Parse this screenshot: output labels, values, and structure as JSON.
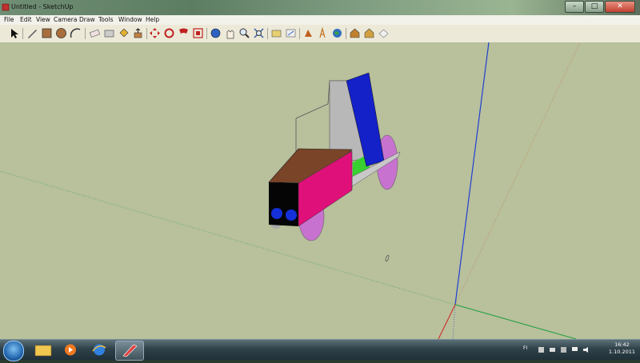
{
  "window": {
    "title": "Untitled - SketchUp"
  },
  "menu": {
    "items": [
      "File",
      "Edit",
      "View",
      "Camera",
      "Draw",
      "Tools",
      "Window",
      "Help"
    ]
  },
  "toolbar": {
    "tools": [
      "select-icon",
      "pencil-icon",
      "rectangle-icon",
      "circle-icon",
      "arc-icon",
      "eraser-icon",
      "tape-icon",
      "paint-bucket-icon",
      "push-pull-icon",
      "move-icon",
      "rotate-icon",
      "offset-icon",
      "orbit-icon",
      "pan-icon",
      "zoom-icon",
      "zoom-extents-icon",
      "components-icon",
      "dimensions-icon",
      "text-icon",
      "axes-icon",
      "3d-text-icon",
      "google-earth-icon",
      "warehouse-icon",
      "share-icon"
    ]
  },
  "taskbar": {
    "language": "FI",
    "time": "16:42",
    "date": "1.10.2011"
  },
  "colors": {
    "sky": "#b8c09c",
    "red_axis": "#d02020",
    "green_axis": "#20a040",
    "blue_axis": "#2040d0",
    "box_magenta": "#e0107a",
    "box_brown": "#7a4428",
    "wheel": "#c86ed0",
    "window_blue": "#1420c8"
  }
}
